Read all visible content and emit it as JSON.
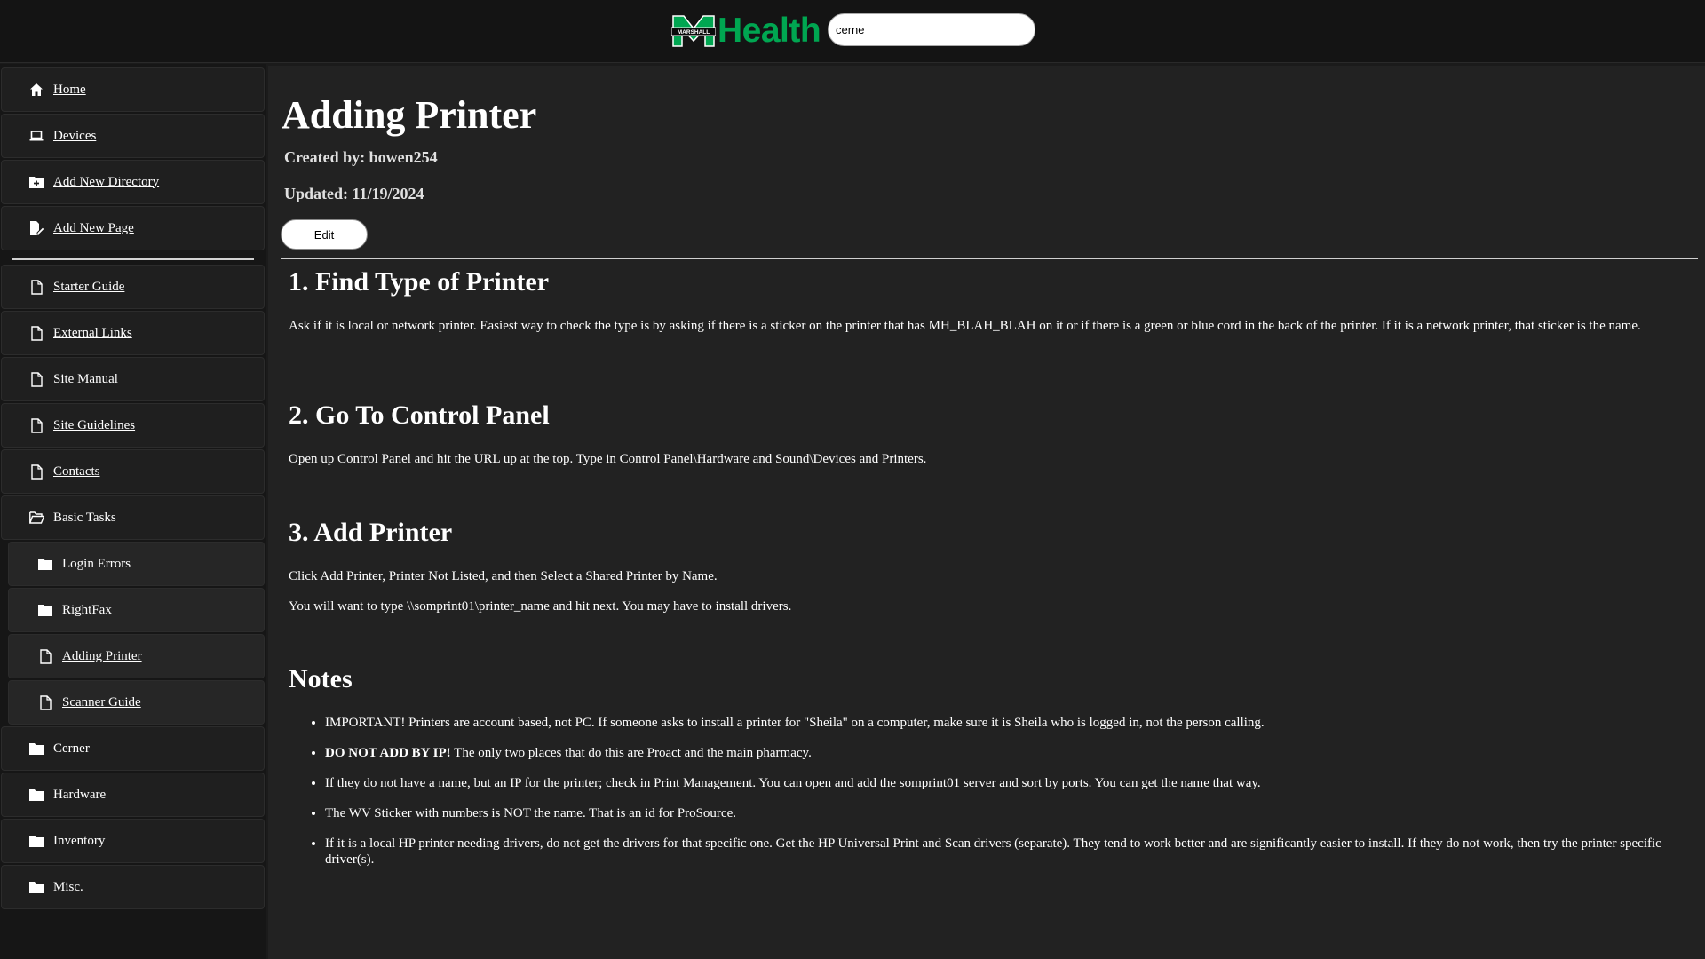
{
  "header": {
    "logo_text": "Health",
    "logo_mark_text": "MARSHALL",
    "brand_color": "#00a651",
    "search_value": "cerne"
  },
  "sidebar": {
    "items": [
      {
        "label": "Home",
        "icon": "home-icon"
      },
      {
        "label": "Devices",
        "icon": "laptop-icon"
      },
      {
        "label": "Add New Directory",
        "icon": "folder-plus-icon"
      },
      {
        "label": "Add New Page",
        "icon": "file-edit-icon"
      },
      {
        "label": "Starter Guide",
        "icon": "file-icon"
      },
      {
        "label": "External Links",
        "icon": "file-icon"
      },
      {
        "label": "Site Manual",
        "icon": "file-icon"
      },
      {
        "label": "Site Guidelines",
        "icon": "file-icon"
      },
      {
        "label": "Contacts",
        "icon": "file-icon"
      },
      {
        "label": "Basic Tasks",
        "icon": "folder-open-icon"
      },
      {
        "label": "Login Errors",
        "icon": "folder-icon"
      },
      {
        "label": "RightFax",
        "icon": "folder-icon"
      },
      {
        "label": "Adding Printer",
        "icon": "file-icon"
      },
      {
        "label": "Scanner Guide",
        "icon": "file-icon"
      },
      {
        "label": "Cerner",
        "icon": "folder-icon"
      },
      {
        "label": "Hardware",
        "icon": "folder-icon"
      },
      {
        "label": "Inventory",
        "icon": "folder-icon"
      },
      {
        "label": "Misc.",
        "icon": "folder-icon"
      }
    ]
  },
  "page": {
    "title": "Adding Printer",
    "created_by": "Created by: bowen254",
    "updated": "Updated: 11/19/2024",
    "edit_label": "Edit",
    "sections": [
      {
        "heading": "1. Find Type of Printer",
        "paragraphs": [
          "Ask if it is local or network printer. Easiest way to check the type is by asking if there is a sticker on the printer that has MH_BLAH_BLAH on it or if there is a green or blue cord in the back of the printer. If it is a network printer, that sticker is the name."
        ]
      },
      {
        "heading": "2. Go To Control Panel",
        "paragraphs": [
          "Open up Control Panel and hit the URL up at the top. Type in Control Panel\\Hardware and Sound\\Devices and Printers."
        ]
      },
      {
        "heading": "3. Add Printer",
        "paragraphs": [
          "Click Add Printer, Printer Not Listed, and then Select a Shared Printer by Name.",
          "You will want to type \\\\somprint01\\printer_name and hit next. You may have to install drivers."
        ]
      }
    ],
    "notes_heading": "Notes",
    "notes": [
      {
        "bold": "",
        "text": "IMPORTANT! Printers are account based, not PC. If someone asks to install a printer for \"Sheila\" on a computer, make sure it is Sheila who is logged in, not the person calling."
      },
      {
        "bold": "DO NOT ADD BY IP!",
        "text": " The only two places that do this are Proact and the main pharmacy."
      },
      {
        "bold": "",
        "text": "If they do not have a name, but an IP for the printer; check in Print Management. You can open and add the somprint01 server and sort by ports. You can get the name that way."
      },
      {
        "bold": "",
        "text": "The WV Sticker with numbers is NOT the name. That is an id for ProSource."
      },
      {
        "bold": "",
        "text": "If it is a local HP printer needing drivers, do not get the drivers for that specific one. Get the HP Universal Print and Scan drivers (separate). They tend to work better and are significantly easier to install. If they do not work, then try the printer specific driver(s)."
      }
    ]
  }
}
